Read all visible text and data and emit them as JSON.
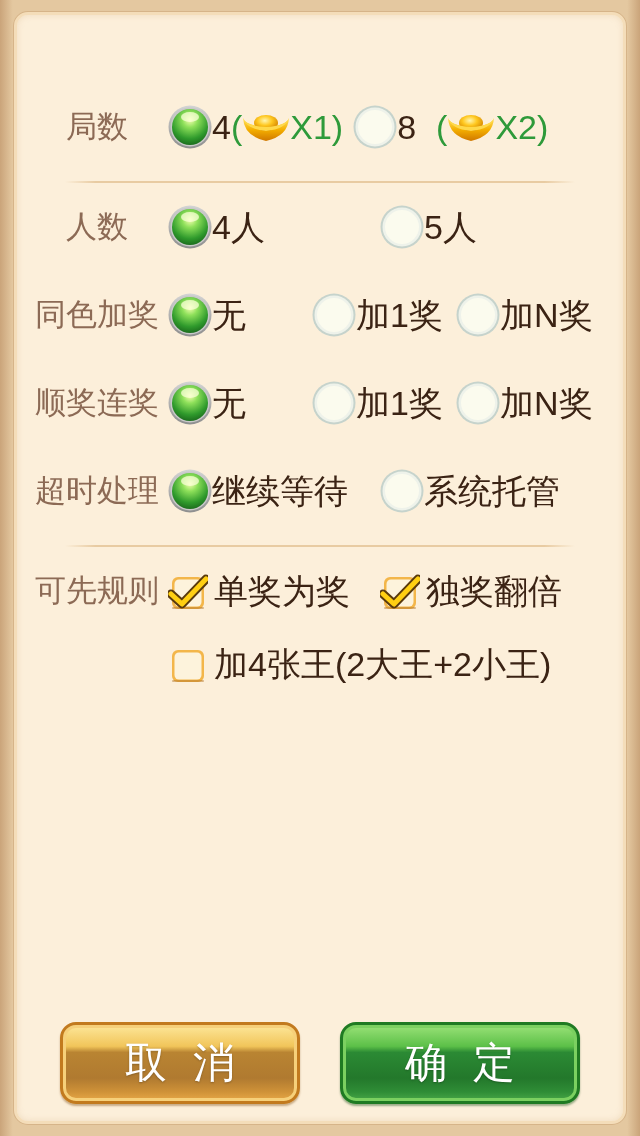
{
  "sections": [
    [
      {
        "label": "局数",
        "kind": "radio",
        "options": [
          {
            "text": "4",
            "bonus": {
              "before": "(",
              "after": "X1)"
            },
            "selected": true
          },
          {
            "text": "8",
            "bonus": {
              "before": "(",
              "after": "X2)"
            },
            "selected": false
          }
        ]
      }
    ],
    [
      {
        "label": "人数",
        "kind": "radio",
        "options": [
          {
            "text": "4人",
            "selected": true
          },
          {
            "text": "5人",
            "selected": false
          }
        ]
      },
      {
        "label": "同色加奖",
        "kind": "radio",
        "options": [
          {
            "text": "无",
            "selected": true
          },
          {
            "text": "加1奖",
            "selected": false
          },
          {
            "text": "加N奖",
            "selected": false
          }
        ]
      },
      {
        "label": "顺奖连奖",
        "kind": "radio",
        "options": [
          {
            "text": "无",
            "selected": true
          },
          {
            "text": "加1奖",
            "selected": false
          },
          {
            "text": "加N奖",
            "selected": false
          }
        ]
      },
      {
        "label": "超时处理",
        "kind": "radio",
        "options": [
          {
            "text": "继续等待",
            "selected": true
          },
          {
            "text": "系统托管",
            "selected": false
          }
        ]
      }
    ],
    [
      {
        "label": "可先规则",
        "kind": "checkbox",
        "options": [
          {
            "text": "单奖为奖",
            "checked": true
          },
          {
            "text": "独奖翻倍",
            "checked": true
          },
          {
            "text": "加4张王(2大王+2小王)",
            "checked": false
          }
        ]
      }
    ]
  ],
  "buttons": [
    {
      "label": "取消",
      "kind": "cancel"
    },
    {
      "label": "确定",
      "kind": "confirm"
    }
  ]
}
